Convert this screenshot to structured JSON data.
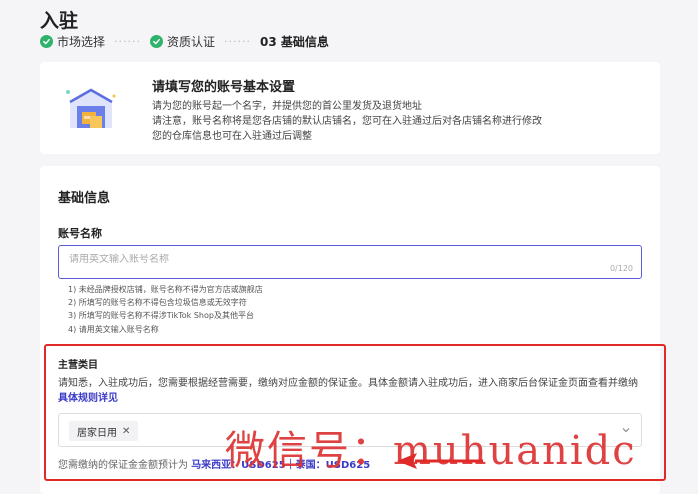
{
  "header": {
    "title": "入驻",
    "steps": [
      {
        "label": "市场选择",
        "state": "done"
      },
      {
        "label": "资质认证",
        "state": "done"
      },
      {
        "label": "03 基础信息",
        "state": "current"
      }
    ],
    "step_separator": "······"
  },
  "intro": {
    "icon": "warehouse-icon",
    "title": "请填写您的账号基本设置",
    "lines": [
      "请为您的账号起一个名字，并提供您的首公里发货及退货地址",
      "请注意，账号名称将是您各店铺的默认店铺名，您可在入驻通过后对各店铺名称进行修改",
      "您的仓库信息也可在入驻通过后调整"
    ]
  },
  "form": {
    "section_title": "基础信息",
    "account_name": {
      "label": "账号名称",
      "placeholder": "请用英文输入账号名称",
      "value": "",
      "counter": "0/120",
      "rules": [
        "1) 未经品牌授权店铺，账号名称不得为官方店或旗舰店",
        "2) 所填写的账号名称不得包含垃圾信息或无效字符",
        "3) 所填写的账号名称不得涉TikTok Shop及其他平台",
        "4) 请用英文输入账号名称"
      ]
    },
    "category": {
      "label": "主营类目",
      "description": "请知悉，入驻成功后，您需要根据经营需要，缴纳对应金额的保证金。具体金额请入驻成功后，进入商家后台保证金页面查看并缴纳",
      "link": "具体规则详见",
      "selected_tag": "居家日用",
      "deposit_prefix": "您需缴纳的保证金金额预计为",
      "deposit_values": "马来西亚：USD625｜泰国：USD625"
    }
  },
  "overlay": {
    "watermark": "微信号：muhuanidc",
    "accent_color": "#e02a2a"
  }
}
